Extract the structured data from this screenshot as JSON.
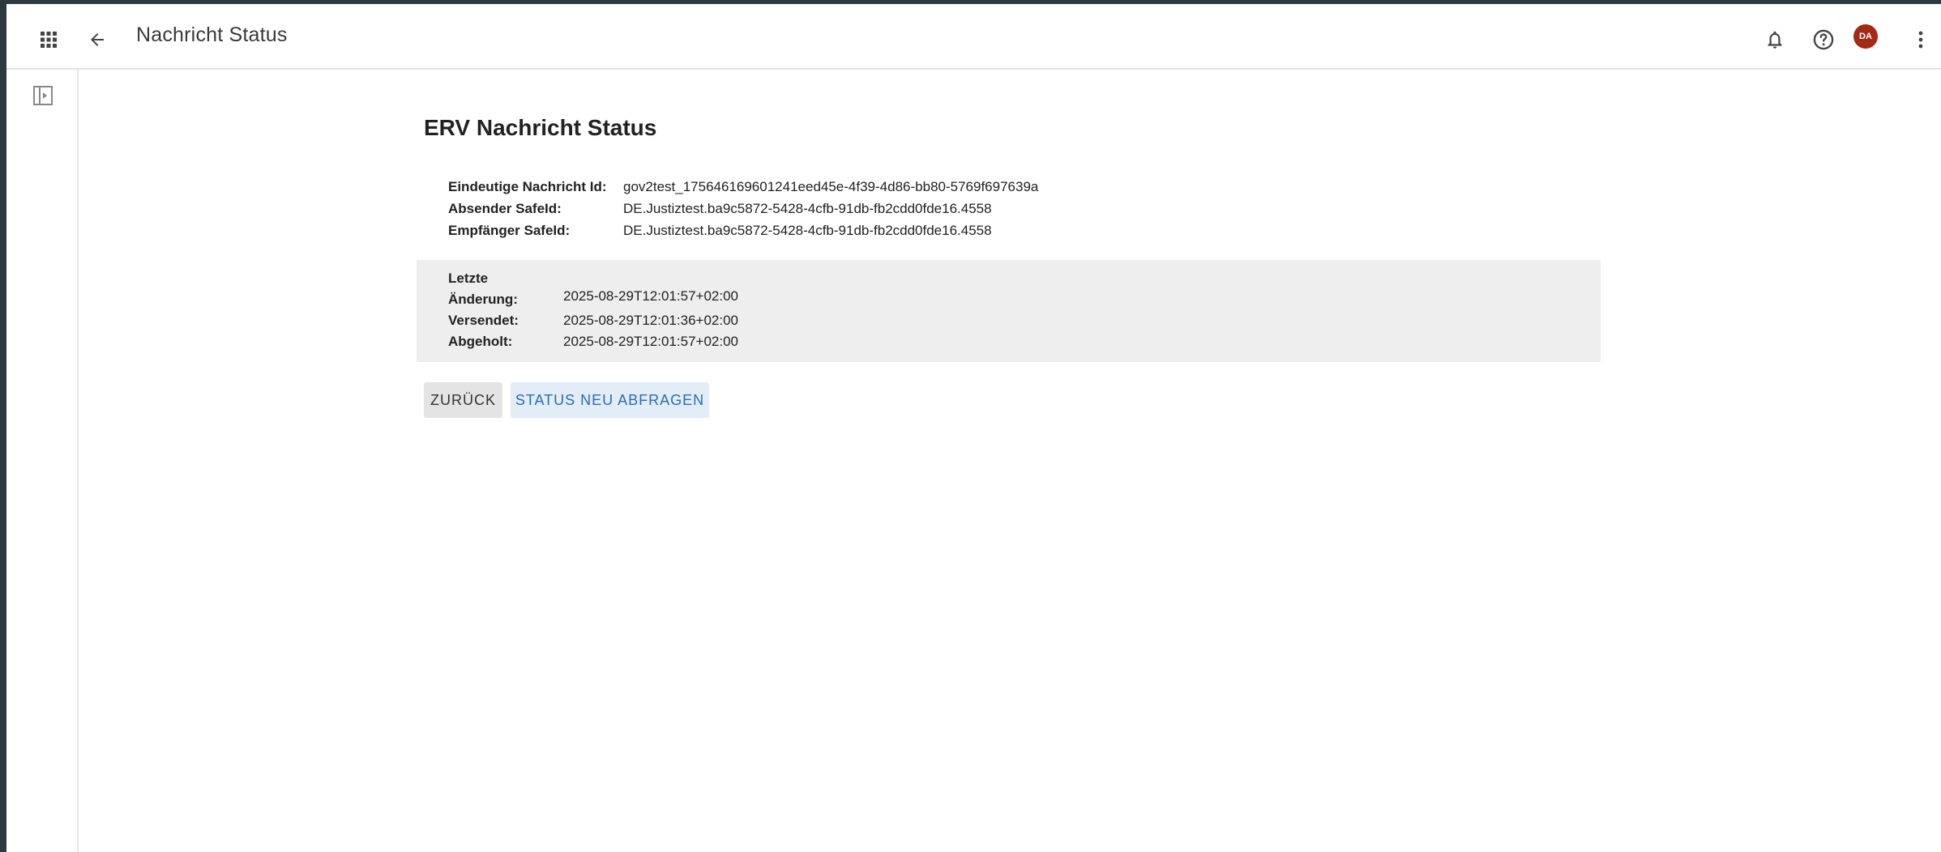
{
  "header": {
    "title": "Nachricht Status",
    "avatar_initials": "DA",
    "avatar_color": "#a32a14"
  },
  "icons": {
    "apps": "apps-grid-icon",
    "back": "arrow-left-icon",
    "notifications": "bell-icon",
    "help": "help-circle-icon",
    "more": "more-vertical-icon",
    "sidebar_toggle": "sidebar-toggle-icon"
  },
  "main": {
    "title": "ERV Nachricht Status",
    "info": [
      {
        "label": "Eindeutige Nachricht Id:",
        "value": "gov2test_175646169601241eed45e-4f39-4d86-bb80-5769f697639a"
      },
      {
        "label": "Absender SafeId:",
        "value": "DE.Justiztest.ba9c5872-5428-4cfb-91db-fb2cdd0fde16.4558"
      },
      {
        "label": "Empfänger SafeId:",
        "value": "DE.Justiztest.ba9c5872-5428-4cfb-91db-fb2cdd0fde16.4558"
      }
    ],
    "status": {
      "last_change_label_line1": "Letzte",
      "last_change_label_line2": "Änderung:",
      "last_change_value": "2025-08-29T12:01:57+02:00",
      "sent_label": "Versendet:",
      "sent_value": "2025-08-29T12:01:36+02:00",
      "fetched_label": "Abgeholt:",
      "fetched_value": "2025-08-29T12:01:57+02:00"
    },
    "buttons": {
      "back_label": "ZURÜCK",
      "refresh_label": "STATUS NEU ABFRAGEN"
    }
  },
  "colors": {
    "accent_text": "#2a6db0",
    "accent_bg": "#e3edf8",
    "status_bg": "#eeeeee"
  }
}
